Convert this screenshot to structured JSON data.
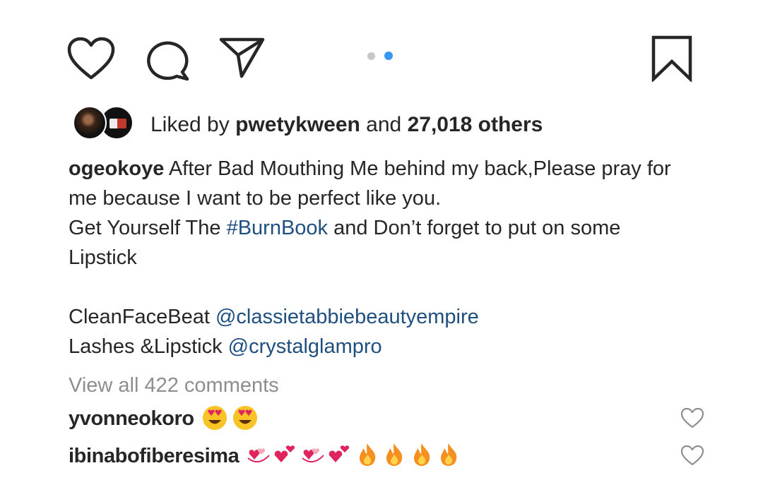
{
  "actions": {
    "icons": [
      "heart-icon",
      "comment-icon",
      "share-icon",
      "bookmark-icon"
    ],
    "carousel": {
      "count": 2,
      "active": 2
    }
  },
  "likes": {
    "prefix": "Liked by",
    "user": "pwetykween",
    "connector": "and",
    "others": "27,018 others"
  },
  "caption": {
    "username": "ogeokoye",
    "line1": "After Bad Mouthing Me behind my back,Please pray for me because I want to be perfect like you.",
    "line2_before": "Get Yourself The ",
    "hashtag": "#BurnBook",
    "line2_after": " and Don’t forget to put on some Lipstick",
    "line3_label": "CleanFaceBeat ",
    "line3_mention": "@classietabbiebeautyempire",
    "line4_label": "Lashes &Lipstick ",
    "line4_mention": "@crystalglampro"
  },
  "comments_link": "View all 422 comments",
  "comments": [
    {
      "user": "yvonneokoro",
      "emojis": [
        "heart-eyes-emoji",
        "heart-eyes-emoji"
      ]
    },
    {
      "user": "ibinabofiberesima",
      "emojis": [
        "revolving-hearts-emoji",
        "two-hearts-emoji",
        "revolving-hearts-emoji",
        "two-hearts-emoji",
        "fire-emoji",
        "fire-emoji",
        "fire-emoji",
        "fire-emoji"
      ]
    }
  ],
  "colors": {
    "text": "#262626",
    "link": "#1f4f7f",
    "muted": "#8e8e8e",
    "active_dot": "#3897f0",
    "inactive_dot": "#c7c7c7"
  }
}
